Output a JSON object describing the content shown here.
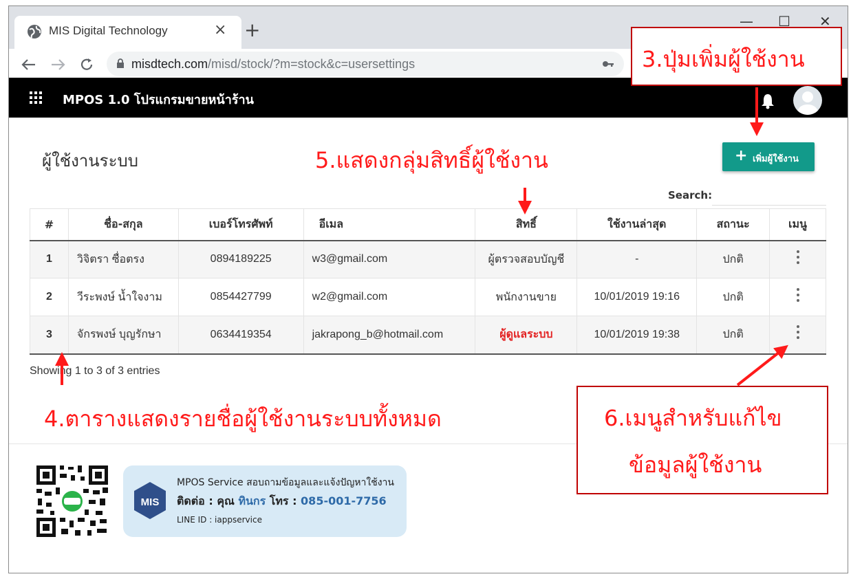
{
  "browser": {
    "tab_title": "MIS Digital Technology",
    "tab_close": "×",
    "new_tab": "+",
    "url_host": "misdtech.com",
    "url_path": "/misd/stock/?m=stock&c=usersettings",
    "minimize": "—",
    "maximize": "☐",
    "close": "✕"
  },
  "app": {
    "title": "MPOS 1.0 โปรแกรมขายหน้าร้าน"
  },
  "page": {
    "title": "ผู้ใช้งานระบบ",
    "add_button": "เพิ่มผู้ใช้งาน",
    "add_button_plus": "+",
    "search_label": "Search:",
    "showing": "Showing 1 to 3 of 3 entries"
  },
  "table": {
    "headers": [
      "#",
      "ชื่อ-สกุล",
      "เบอร์โทรศัพท์",
      "อีเมล",
      "สิทธิ์",
      "ใช้งานล่าสุด",
      "สถานะ",
      "เมนู"
    ],
    "rows": [
      {
        "num": "1",
        "name": "วิจิตรา ซื่อตรง",
        "phone": "0894189225",
        "email": "w3@gmail.com",
        "role": "ผู้ตรวจสอบบัญชี",
        "last": "-",
        "status": "ปกติ"
      },
      {
        "num": "2",
        "name": "วีระพงษ์ น้ำใจงาม",
        "phone": "0854427799",
        "email": "w2@gmail.com",
        "role": "พนักงานขาย",
        "last": "10/01/2019 19:16",
        "status": "ปกติ"
      },
      {
        "num": "3",
        "name": "จักรพงษ์ บุญรักษา",
        "phone": "0634419354",
        "email": "jakrapong_b@hotmail.com",
        "role": "ผู้ดูแลระบบ",
        "last": "10/01/2019 19:38",
        "status": "ปกติ"
      }
    ]
  },
  "footer": {
    "logo_text": "MIS",
    "line1": "MPOS Service สอบถามข้อมูลและแจ้งปัญหาใช้งาน",
    "line2_prefix": "ติดต่อ : คุณ ",
    "line2_name": "ทินกร",
    "line2_mid": " โทร : ",
    "line2_phone": "085-001-7756",
    "line3": "LINE ID : iappservice"
  },
  "annotations": {
    "a3": "3.ปุ่มเพิ่มผู้ใช้งาน",
    "a4": "4.ตารางแสดงรายชื่อผู้ใช้งานระบบทั้งหมด",
    "a5": "5.แสดงกลุ่มสิทธิ์ผู้ใช้งาน",
    "a6_line1": "6.เมนูสำหรับแก้ไข",
    "a6_line2": "ข้อมูลผู้ใช้งาน"
  },
  "colors": {
    "header_bg": "#000000",
    "accent": "#129a8a",
    "annotation": "#ff1a1a",
    "admin_role": "#e32222"
  }
}
